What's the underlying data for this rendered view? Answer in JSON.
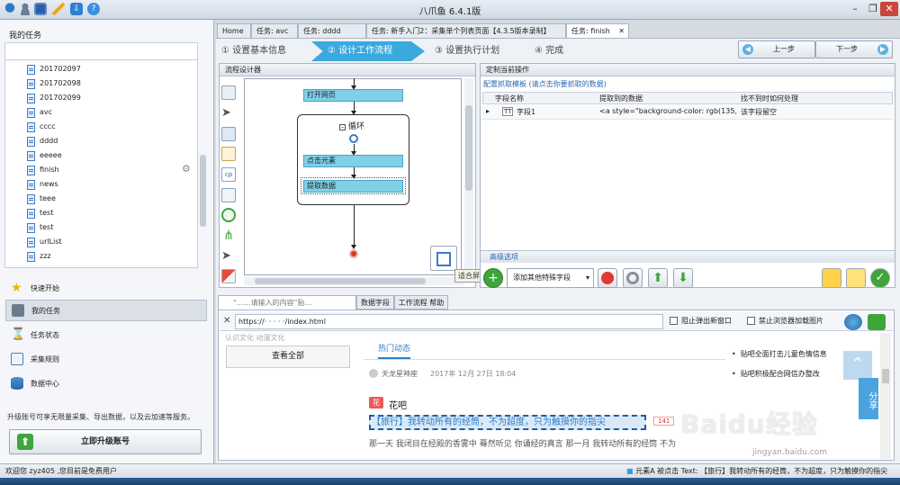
{
  "window": {
    "title": "八爪鱼 6.4.1版",
    "controls": [
      "–",
      "❐",
      "✕"
    ]
  },
  "quick_icons": [
    "app-logo",
    "user",
    "save",
    "edit",
    "download",
    "help"
  ],
  "left": {
    "section_title": "我的任务",
    "tasks": [
      "201702097",
      "201702098",
      "201702099",
      "avc",
      "cccc",
      "dddd",
      "eeeee",
      "finish",
      "news",
      "teee",
      "test",
      "test",
      "urlList",
      "zzz"
    ],
    "nav": [
      "快速开始",
      "我的任务",
      "任务状态",
      "采集规则",
      "数据中心"
    ],
    "upgrade_text": "升级账号可享无限量采集、导出数据，以及云加速等服务。",
    "upgrade_button": "立即升级账号"
  },
  "tabs": [
    "Home",
    "任务: avc",
    "任务: dddd",
    "任务: 新手入门2：采集单个列表页面【4.3.5版本录制】",
    "任务: finish"
  ],
  "tab_close": "✕",
  "steps": [
    "① 设置基本信息",
    "② 设计工作流程",
    "③ 设置执行计划",
    "④ 完成"
  ],
  "prev_button": "上一步",
  "next_button": "下一步",
  "flow": {
    "panel_title": "流程设计器",
    "nodes": {
      "open_page": "打开网页",
      "loop": "循环",
      "click": "点击元素",
      "extract": "提取数据"
    },
    "tooltip": "适合屏幕大小"
  },
  "define": {
    "panel_title": "定制当前操作",
    "template_link": "配置抓取模板 (请点击你要抓取的数据)",
    "headers": [
      "字段名称",
      "提取到的数据",
      "找不到时如何处理"
    ],
    "row": {
      "marker": "▸",
      "type": "TT",
      "name": "字段1",
      "data": "<a style=\"background-color: rgb(135, ...",
      "handling": "该字段留空"
    },
    "advanced": "高级选项",
    "add_special": "添加其他特殊字段"
  },
  "browser": {
    "tabs": [
      "\"……请输入的内容\"贴…",
      "数据字段",
      "工作流程 帮助"
    ],
    "url": "https://·  ·  ·  · ·/index.html",
    "block_popup": "阻止弹出新窗口",
    "disable_images": "禁止浏览器加载图片",
    "faint_text": "认识文化 动漫文化",
    "view_all": "查看全部",
    "hot_tab": "热门动态",
    "author": "天龙星神座",
    "post_date": "2017年 12月 27日 18:04",
    "forum_badge": "花",
    "forum_name": "花吧",
    "headline": "【旅行】我转动所有的经筒，不为超度，只为触摸你的指尖",
    "count": "141",
    "excerpt": "那一天 我闭目在经殿的香雾中 蓦然听见 你诵经的真言 那一月 我转动所有的经筒 不为",
    "side_links": [
      "贴吧全面打击儿童色情信息",
      "贴吧积极配合网信办整改"
    ],
    "share_text": "分享",
    "watermark": "Baidu经验",
    "watermark_url": "jingyan.baidu.com"
  },
  "status": {
    "left": "欢迎您 zyz405 ,您目前是免费用户",
    "right": "元素A 被点击 Text: 【旅行】我转动所有的经筒，不为超度，只为触摸你的指尖"
  },
  "colors": {
    "accent": "#2a9fd6",
    "active_step": "#3aa9de",
    "flow_node": "#7fd0e8",
    "highlight": "#2a7fc8"
  }
}
